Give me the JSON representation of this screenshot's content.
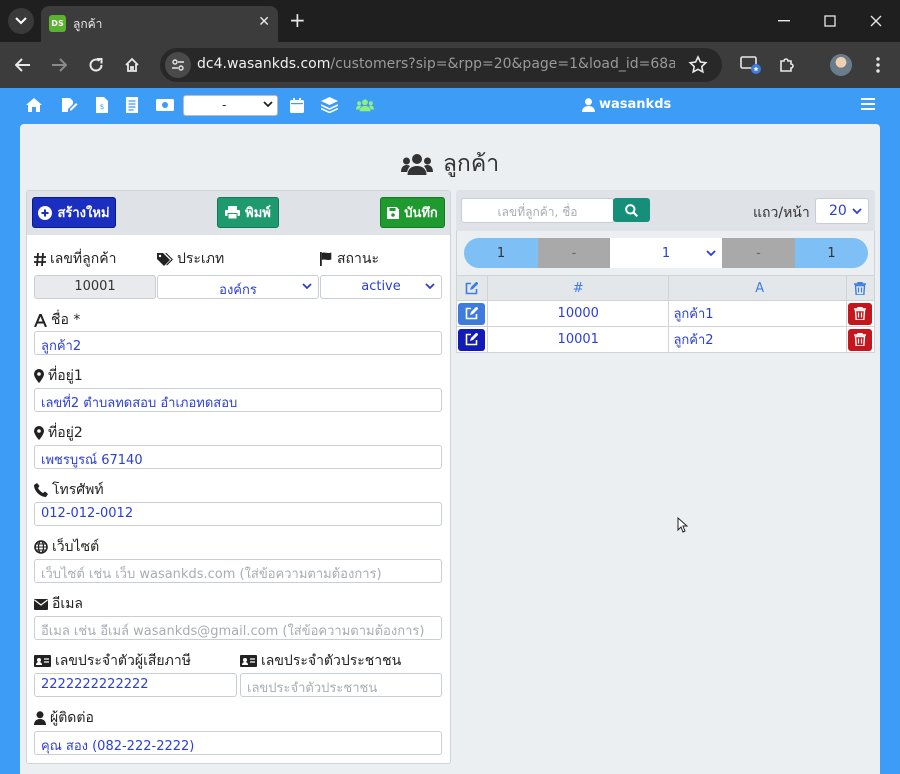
{
  "browser": {
    "tab_title": "ลูกค้า",
    "favicon_text": "DS",
    "url_host": "dc4.wasankds.com",
    "url_path": "/customers?sip=&rpp=20&page=1&load_id=68afd419..."
  },
  "navbar": {
    "select_value": "-",
    "username": "wasankds"
  },
  "page": {
    "title": "ลูกค้า"
  },
  "form": {
    "toolbar": {
      "new_label": "สร้างใหม่",
      "print_label": "พิมพ์",
      "save_label": "บันทึก"
    },
    "fields": {
      "customer_id": {
        "label": "เลขที่ลูกค้า",
        "value": "10001"
      },
      "type": {
        "label": "ประเภท",
        "value": "องค์กร"
      },
      "status": {
        "label": "สถานะ",
        "value": "active"
      },
      "name": {
        "label": "ชื่อ *",
        "value": "ลูกค้า2"
      },
      "address1": {
        "label": "ที่อยู่1",
        "value": "เลขที่2 ตำบลทดสอบ อำเภอทดสอบ"
      },
      "address2": {
        "label": "ที่อยู่2",
        "value": "เพชรบูรณ์ 67140"
      },
      "phone": {
        "label": "โทรศัพท์",
        "value": "012-012-0012"
      },
      "website": {
        "label": "เว็บไซต์",
        "placeholder": "เว็บไซต์ เช่น เว็บ wasankds.com (ใส่ข้อความตามต้องการ)"
      },
      "email": {
        "label": "อีเมล",
        "placeholder": "อีเมล เช่น อีเมล์ wasankds@gmail.com (ใส่ข้อความตามต้องการ)"
      },
      "tax_id": {
        "label": "เลขประจำตัวผู้เสียภาษี",
        "value": "2222222222222"
      },
      "citizen_id": {
        "label": "เลขประจำตัวประชาชน",
        "placeholder": "เลขประจำตัวประชาชน"
      },
      "contact": {
        "label": "ผู้ติดต่อ",
        "value": "คุณ สอง (082-222-2222)"
      }
    }
  },
  "list": {
    "search_placeholder": "เลขที่ลูกค้า, ชื่อ",
    "rpp_label": "แถว/หน้า",
    "rpp_value": "20",
    "pager": {
      "first": "1",
      "prev": "-",
      "current": "1",
      "next": "-",
      "last": "1"
    },
    "columns": {
      "id": "#",
      "name": "A"
    },
    "rows": [
      {
        "id": "10000",
        "name": "ลูกค้า1"
      },
      {
        "id": "10001",
        "name": "ลูกค้า2"
      }
    ]
  }
}
